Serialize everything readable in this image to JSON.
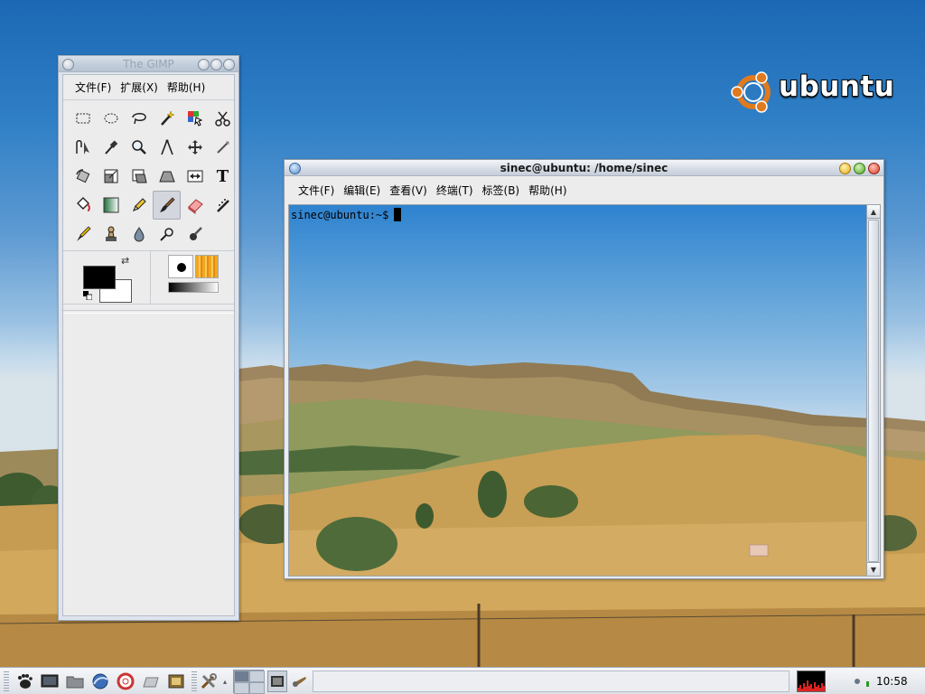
{
  "desktop": {
    "logo_text": "ubuntu"
  },
  "gimp": {
    "title": "The GIMP",
    "menu": [
      "文件(F)",
      "扩展(X)",
      "帮助(H)"
    ],
    "tools": [
      "rect-select",
      "ellipse-select",
      "free-select",
      "fuzzy-select",
      "color-select",
      "scissors",
      "paths",
      "color-picker",
      "zoom",
      "measure",
      "move",
      "crop",
      "rotate",
      "scale",
      "shear",
      "perspective",
      "flip",
      "text",
      "bucket-fill",
      "blend",
      "pencil",
      "paintbrush",
      "eraser",
      "airbrush",
      "ink",
      "clone",
      "blur",
      "dodge-burn",
      "smudge"
    ],
    "active_tool": "paintbrush",
    "fg_color": "#000000",
    "bg_color": "#ffffff"
  },
  "terminal": {
    "title": "sinec@ubuntu: /home/sinec",
    "menu": [
      "文件(F)",
      "编辑(E)",
      "查看(V)",
      "终端(T)",
      "标签(B)",
      "帮助(H)"
    ],
    "prompt": "sinec@ubuntu:~$"
  },
  "panel": {
    "launchers": [
      "gnome-foot-icon",
      "desktop-icon",
      "file-manager-icon",
      "browser-icon",
      "help-icon",
      "terminal-icon",
      "video-editor-icon"
    ],
    "tools_icon": "tools-icon",
    "tasks": [
      "terminal-task-icon",
      "gimp-task-icon"
    ],
    "clock": "10:58"
  },
  "colors": {
    "accent": "#3c6aa5",
    "panel_bg": "#dde1e7"
  }
}
